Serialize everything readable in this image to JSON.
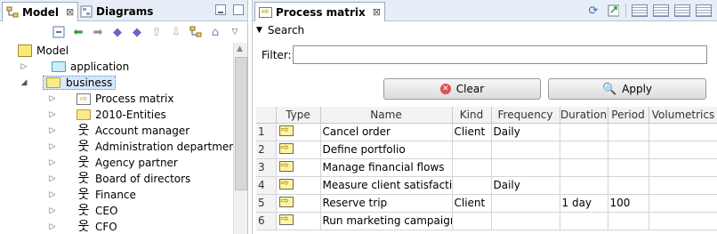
{
  "left": {
    "tabs": [
      {
        "label": "Model",
        "close": "⊠"
      },
      {
        "label": "Diagrams"
      }
    ],
    "tree": [
      {
        "label": "Model",
        "kind": "model",
        "twisty": ""
      },
      {
        "label": "application",
        "kind": "folder-cyan",
        "twisty": "▷"
      },
      {
        "label": "business",
        "kind": "folder",
        "twisty": "◢"
      },
      {
        "label": "Process matrix",
        "kind": "matrix",
        "twisty": "▷"
      },
      {
        "label": "2010-Entities",
        "kind": "folder",
        "twisty": "▷"
      },
      {
        "label": "Account manager",
        "kind": "actor",
        "twisty": "▷"
      },
      {
        "label": "Administration department",
        "kind": "actor",
        "twisty": "▷"
      },
      {
        "label": "Agency partner",
        "kind": "actor",
        "twisty": "▷"
      },
      {
        "label": "Board of directors",
        "kind": "actor",
        "twisty": "▷"
      },
      {
        "label": "Finance",
        "kind": "actor",
        "twisty": "▷"
      },
      {
        "label": "CEO",
        "kind": "actor",
        "twisty": "▷"
      },
      {
        "label": "CFO",
        "kind": "actor",
        "twisty": "▷"
      }
    ]
  },
  "right": {
    "tab_label": "Process matrix",
    "tab_close": "⊠",
    "search_label": "Search",
    "filter_label": "Filter:",
    "filter_value": "",
    "clear_label": "Clear",
    "apply_label": "Apply",
    "columns": [
      "Type",
      "Name",
      "Kind",
      "Frequency",
      "Duration",
      "Period",
      "Volumetrics"
    ],
    "rows": [
      {
        "num": "1",
        "name": "Cancel order",
        "kind": "Client",
        "frequency": "Daily",
        "duration": "",
        "period": "",
        "volumetrics": ""
      },
      {
        "num": "2",
        "name": "Define portfolio",
        "kind": "",
        "frequency": "",
        "duration": "",
        "period": "",
        "volumetrics": ""
      },
      {
        "num": "3",
        "name": "Manage financial flows",
        "kind": "",
        "frequency": "",
        "duration": "",
        "period": "",
        "volumetrics": ""
      },
      {
        "num": "4",
        "name": "Measure client satisfaction",
        "kind": "",
        "frequency": "Daily",
        "duration": "",
        "period": "",
        "volumetrics": ""
      },
      {
        "num": "5",
        "name": "Reserve trip",
        "kind": "Client",
        "frequency": "",
        "duration": "1 day",
        "period": "100",
        "volumetrics": ""
      },
      {
        "num": "6",
        "name": "Run marketing campaign",
        "kind": "",
        "frequency": "",
        "duration": "",
        "period": "",
        "volumetrics": ""
      }
    ]
  }
}
